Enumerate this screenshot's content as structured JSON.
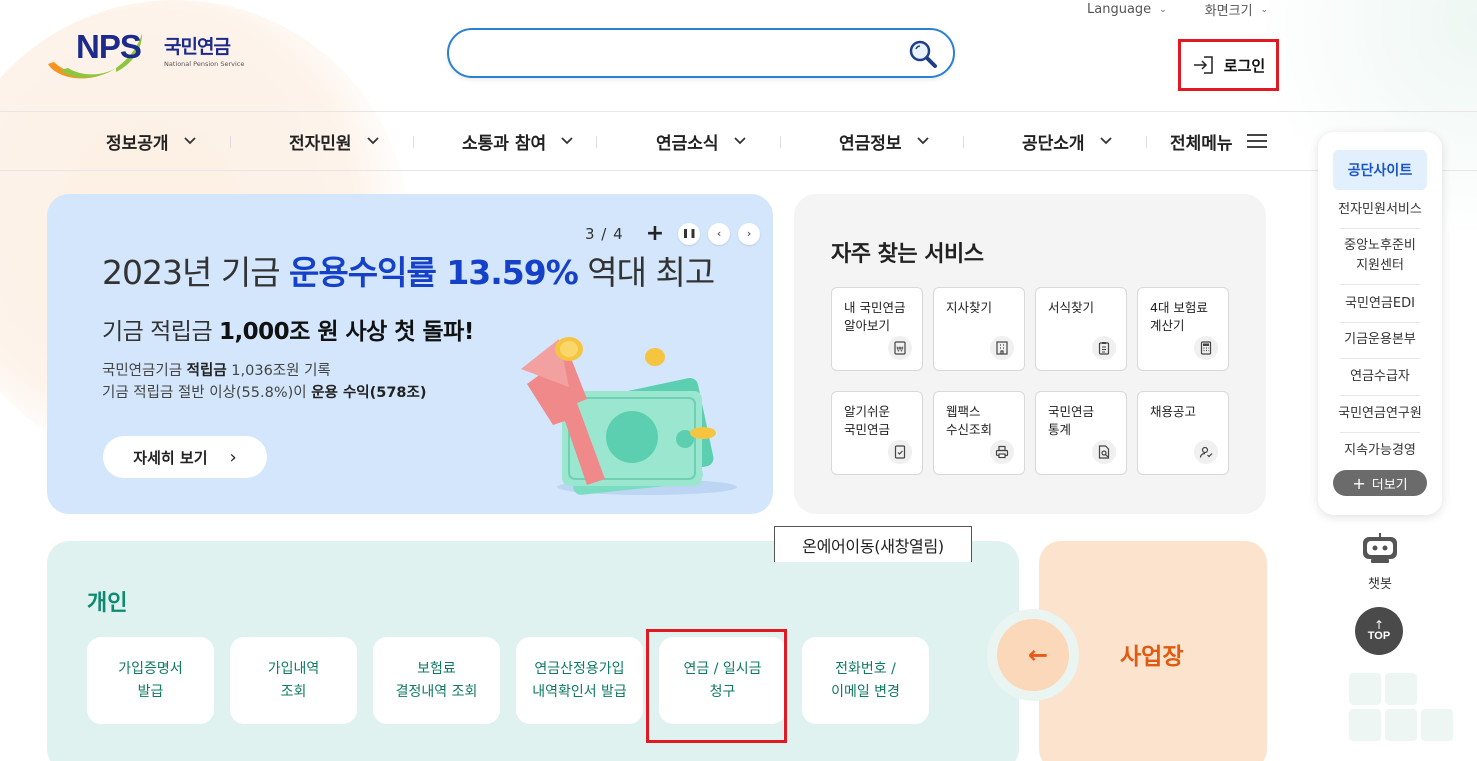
{
  "header": {
    "language_label": "Language",
    "font_size_label": "화면크기",
    "logo_abbr": "NPS",
    "logo_kr": "국민연금",
    "logo_en": "National Pension Service",
    "search_placeholder": "",
    "login_label": "로그인"
  },
  "nav": {
    "items": [
      "정보공개",
      "전자민원",
      "소통과 참여",
      "연금소식",
      "연금정보",
      "공단소개"
    ],
    "all_menu": "전체메뉴"
  },
  "banner": {
    "pager": "3 / 4",
    "title_pre": "2023년 기금 ",
    "title_highlight": "운용수익률 13.59%",
    "title_post": " 역대 최고",
    "sub_pre": "기금 적립금 ",
    "sub_bold": "1,000조 원 사상 첫 돌파!",
    "desc1_pre": "국민연금기금 ",
    "desc1_bold": "적립금",
    "desc1_post": " 1,036조원 기록",
    "desc2_pre": "기금 적립금 절반 이상(55.8%)이 ",
    "desc2_bold": "운용 수익(578조)",
    "more_label": "자세히 보기"
  },
  "frequent": {
    "title": "자주 찾는 서비스",
    "items": [
      {
        "line1": "내 국민연금",
        "line2": "알아보기",
        "icon": "won-doc-icon"
      },
      {
        "line1": "지사찾기",
        "line2": "",
        "icon": "building-icon"
      },
      {
        "line1": "서식찾기",
        "line2": "",
        "icon": "clipboard-icon"
      },
      {
        "line1": "4대 보험료",
        "line2": "계산기",
        "icon": "calculator-icon"
      },
      {
        "line1": "알기쉬운",
        "line2": "국민연금",
        "icon": "check-doc-icon"
      },
      {
        "line1": "웹팩스",
        "line2": "수신조회",
        "icon": "fax-icon"
      },
      {
        "line1": "국민연금",
        "line2": "통계",
        "icon": "search-doc-icon"
      },
      {
        "line1": "채용공고",
        "line2": "",
        "icon": "person-check-icon"
      }
    ]
  },
  "side": {
    "head": "공단사이트",
    "items": [
      {
        "line1": "전자민원서비스",
        "line2": ""
      },
      {
        "line1": "중앙노후준비",
        "line2": "지원센터"
      },
      {
        "line1": "국민연금EDI",
        "line2": ""
      },
      {
        "line1": "기금운용본부",
        "line2": ""
      },
      {
        "line1": "연금수급자",
        "line2": ""
      },
      {
        "line1": "국민연금연구원",
        "line2": ""
      },
      {
        "line1": "지속가능경영",
        "line2": ""
      }
    ],
    "more_label": "더보기",
    "chatbot_label": "챗봇",
    "top_label": "TOP"
  },
  "personal": {
    "title": "개인",
    "items": [
      {
        "line1": "가입증명서",
        "line2": "발급"
      },
      {
        "line1": "가입내역",
        "line2": "조회"
      },
      {
        "line1": "보험료",
        "line2": "결정내역 조회"
      },
      {
        "line1": "연금산정용가입",
        "line2": "내역확인서 발급"
      },
      {
        "line1": "연금 / 일시금",
        "line2": "청구"
      },
      {
        "line1": "전화번호 /",
        "line2": "이메일 변경"
      }
    ],
    "tooltip": "온에어이동(새창열림)"
  },
  "business": {
    "label": "사업장"
  },
  "colors": {
    "brand_navy": "#1c2a8c",
    "banner_highlight": "#1540c8",
    "personal_green": "#0f8a70",
    "business_orange": "#e05a10",
    "annotation_red": "#e01a22"
  }
}
